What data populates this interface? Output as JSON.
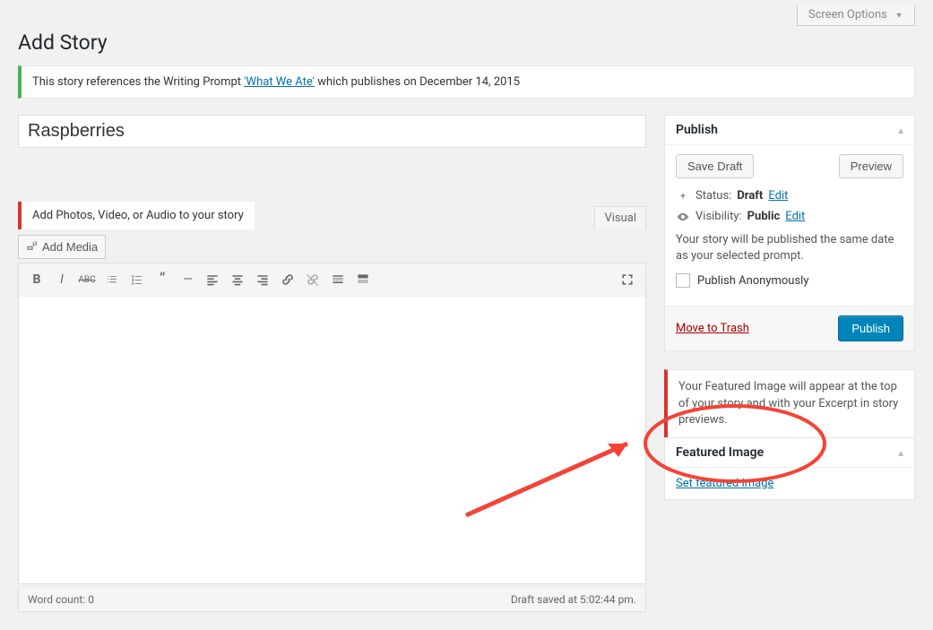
{
  "screen_options": "Screen Options",
  "page_title": "Add Story",
  "notice": {
    "prefix": "This story references the Writing Prompt ",
    "link": "'What We Ate'",
    "suffix": " which publishes on December 14, 2015"
  },
  "title_value": "Raspberries",
  "media_tip": "Add Photos, Video, or Audio to your story",
  "visual_tab": "Visual",
  "add_media": "Add Media",
  "word_count_label": "Word count: ",
  "word_count_value": "0",
  "draft_saved": "Draft saved at 5:02:44 pm.",
  "publish": {
    "heading": "Publish",
    "save_draft": "Save Draft",
    "preview": "Preview",
    "status_label": "Status: ",
    "status_value": "Draft",
    "visibility_label": "Visibility: ",
    "visibility_value": "Public",
    "edit": "Edit",
    "note": "Your story will be published the same date as your selected prompt.",
    "anonymous": "Publish Anonymously",
    "trash": "Move to Trash",
    "publish_btn": "Publish"
  },
  "featured": {
    "notice": "Your Featured Image will appear at the top of your story and with your Excerpt in story previews.",
    "heading": "Featured Image",
    "link": "Set featured image"
  }
}
